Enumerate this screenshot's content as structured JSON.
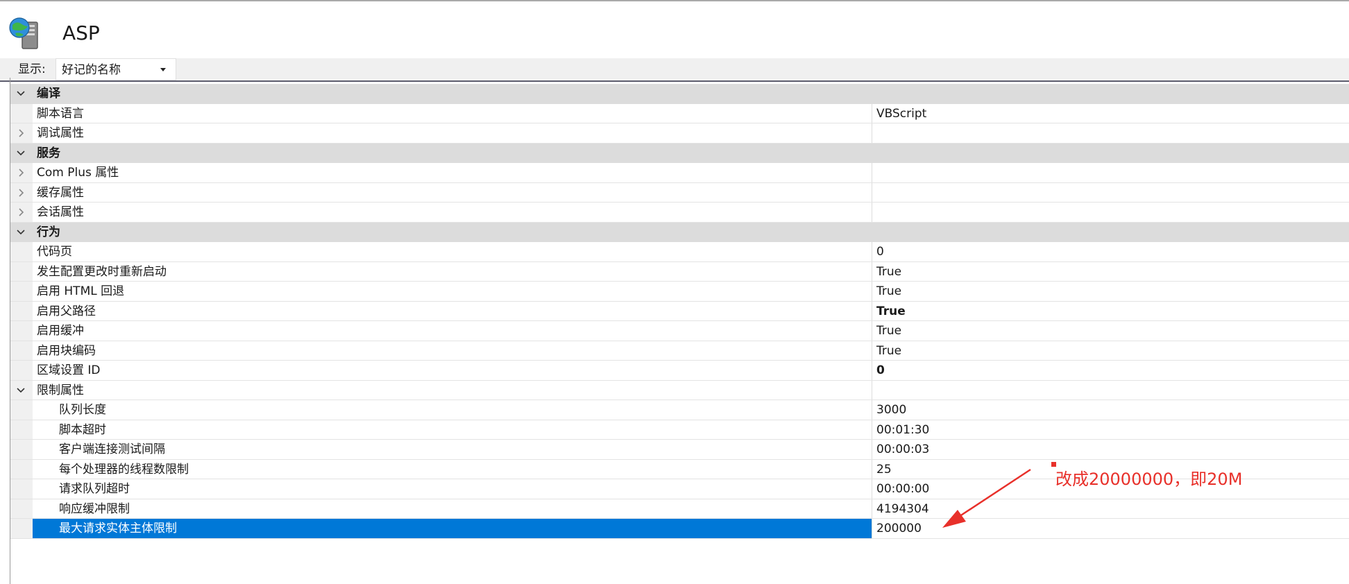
{
  "header": {
    "title": "ASP",
    "icon": "server-globe-icon"
  },
  "toolbar": {
    "show_label": "显示:",
    "show_value": "好记的名称"
  },
  "colors": {
    "selection": "#0078d7",
    "category_bg": "#dcdcdc",
    "annotation": "#e8302a"
  },
  "grid": {
    "rows": [
      {
        "name": "编译",
        "value": "",
        "kind": "category",
        "toggle": "expanded"
      },
      {
        "name": "脚本语言",
        "value": "VBScript"
      },
      {
        "name": "调试属性",
        "value": "",
        "toggle": "collapsed"
      },
      {
        "name": "服务",
        "value": "",
        "kind": "category",
        "toggle": "expanded"
      },
      {
        "name": "Com Plus 属性",
        "value": "",
        "toggle": "collapsed"
      },
      {
        "name": "缓存属性",
        "value": "",
        "toggle": "collapsed"
      },
      {
        "name": "会话属性",
        "value": "",
        "toggle": "collapsed"
      },
      {
        "name": "行为",
        "value": "",
        "kind": "category",
        "toggle": "expanded"
      },
      {
        "name": "代码页",
        "value": "0"
      },
      {
        "name": "发生配置更改时重新启动",
        "value": "True"
      },
      {
        "name": "启用 HTML 回退",
        "value": "True"
      },
      {
        "name": "启用父路径",
        "value": "True",
        "bold_value": true
      },
      {
        "name": "启用缓冲",
        "value": "True"
      },
      {
        "name": "启用块编码",
        "value": "True"
      },
      {
        "name": "区域设置 ID",
        "value": "0",
        "bold_value": true
      },
      {
        "name": "限制属性",
        "value": "",
        "toggle": "expanded"
      },
      {
        "name": "队列长度",
        "value": "3000",
        "indent": true
      },
      {
        "name": "脚本超时",
        "value": "00:01:30",
        "indent": true
      },
      {
        "name": "客户端连接测试间隔",
        "value": "00:00:03",
        "indent": true
      },
      {
        "name": "每个处理器的线程数限制",
        "value": "25",
        "indent": true
      },
      {
        "name": "请求队列超时",
        "value": "00:00:00",
        "indent": true
      },
      {
        "name": "响应缓冲限制",
        "value": "4194304",
        "indent": true
      },
      {
        "name": "最大请求实体主体限制",
        "value": "200000",
        "indent": true,
        "selected": true
      }
    ]
  },
  "annotation": {
    "text": "改成20000000，即20M"
  }
}
